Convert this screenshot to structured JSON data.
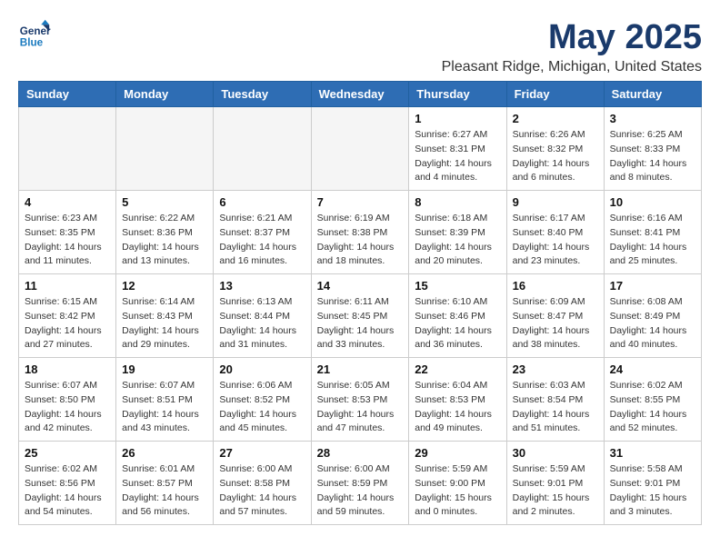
{
  "header": {
    "logo_line1": "General",
    "logo_line2": "Blue",
    "month_title": "May 2025",
    "location": "Pleasant Ridge, Michigan, United States"
  },
  "weekdays": [
    "Sunday",
    "Monday",
    "Tuesday",
    "Wednesday",
    "Thursday",
    "Friday",
    "Saturday"
  ],
  "weeks": [
    [
      {
        "day": "",
        "info": "",
        "empty": true
      },
      {
        "day": "",
        "info": "",
        "empty": true
      },
      {
        "day": "",
        "info": "",
        "empty": true
      },
      {
        "day": "",
        "info": "",
        "empty": true
      },
      {
        "day": "1",
        "info": "Sunrise: 6:27 AM\nSunset: 8:31 PM\nDaylight: 14 hours\nand 4 minutes."
      },
      {
        "day": "2",
        "info": "Sunrise: 6:26 AM\nSunset: 8:32 PM\nDaylight: 14 hours\nand 6 minutes."
      },
      {
        "day": "3",
        "info": "Sunrise: 6:25 AM\nSunset: 8:33 PM\nDaylight: 14 hours\nand 8 minutes."
      }
    ],
    [
      {
        "day": "4",
        "info": "Sunrise: 6:23 AM\nSunset: 8:35 PM\nDaylight: 14 hours\nand 11 minutes."
      },
      {
        "day": "5",
        "info": "Sunrise: 6:22 AM\nSunset: 8:36 PM\nDaylight: 14 hours\nand 13 minutes."
      },
      {
        "day": "6",
        "info": "Sunrise: 6:21 AM\nSunset: 8:37 PM\nDaylight: 14 hours\nand 16 minutes."
      },
      {
        "day": "7",
        "info": "Sunrise: 6:19 AM\nSunset: 8:38 PM\nDaylight: 14 hours\nand 18 minutes."
      },
      {
        "day": "8",
        "info": "Sunrise: 6:18 AM\nSunset: 8:39 PM\nDaylight: 14 hours\nand 20 minutes."
      },
      {
        "day": "9",
        "info": "Sunrise: 6:17 AM\nSunset: 8:40 PM\nDaylight: 14 hours\nand 23 minutes."
      },
      {
        "day": "10",
        "info": "Sunrise: 6:16 AM\nSunset: 8:41 PM\nDaylight: 14 hours\nand 25 minutes."
      }
    ],
    [
      {
        "day": "11",
        "info": "Sunrise: 6:15 AM\nSunset: 8:42 PM\nDaylight: 14 hours\nand 27 minutes."
      },
      {
        "day": "12",
        "info": "Sunrise: 6:14 AM\nSunset: 8:43 PM\nDaylight: 14 hours\nand 29 minutes."
      },
      {
        "day": "13",
        "info": "Sunrise: 6:13 AM\nSunset: 8:44 PM\nDaylight: 14 hours\nand 31 minutes."
      },
      {
        "day": "14",
        "info": "Sunrise: 6:11 AM\nSunset: 8:45 PM\nDaylight: 14 hours\nand 33 minutes."
      },
      {
        "day": "15",
        "info": "Sunrise: 6:10 AM\nSunset: 8:46 PM\nDaylight: 14 hours\nand 36 minutes."
      },
      {
        "day": "16",
        "info": "Sunrise: 6:09 AM\nSunset: 8:47 PM\nDaylight: 14 hours\nand 38 minutes."
      },
      {
        "day": "17",
        "info": "Sunrise: 6:08 AM\nSunset: 8:49 PM\nDaylight: 14 hours\nand 40 minutes."
      }
    ],
    [
      {
        "day": "18",
        "info": "Sunrise: 6:07 AM\nSunset: 8:50 PM\nDaylight: 14 hours\nand 42 minutes."
      },
      {
        "day": "19",
        "info": "Sunrise: 6:07 AM\nSunset: 8:51 PM\nDaylight: 14 hours\nand 43 minutes."
      },
      {
        "day": "20",
        "info": "Sunrise: 6:06 AM\nSunset: 8:52 PM\nDaylight: 14 hours\nand 45 minutes."
      },
      {
        "day": "21",
        "info": "Sunrise: 6:05 AM\nSunset: 8:53 PM\nDaylight: 14 hours\nand 47 minutes."
      },
      {
        "day": "22",
        "info": "Sunrise: 6:04 AM\nSunset: 8:53 PM\nDaylight: 14 hours\nand 49 minutes."
      },
      {
        "day": "23",
        "info": "Sunrise: 6:03 AM\nSunset: 8:54 PM\nDaylight: 14 hours\nand 51 minutes."
      },
      {
        "day": "24",
        "info": "Sunrise: 6:02 AM\nSunset: 8:55 PM\nDaylight: 14 hours\nand 52 minutes."
      }
    ],
    [
      {
        "day": "25",
        "info": "Sunrise: 6:02 AM\nSunset: 8:56 PM\nDaylight: 14 hours\nand 54 minutes."
      },
      {
        "day": "26",
        "info": "Sunrise: 6:01 AM\nSunset: 8:57 PM\nDaylight: 14 hours\nand 56 minutes."
      },
      {
        "day": "27",
        "info": "Sunrise: 6:00 AM\nSunset: 8:58 PM\nDaylight: 14 hours\nand 57 minutes."
      },
      {
        "day": "28",
        "info": "Sunrise: 6:00 AM\nSunset: 8:59 PM\nDaylight: 14 hours\nand 59 minutes."
      },
      {
        "day": "29",
        "info": "Sunrise: 5:59 AM\nSunset: 9:00 PM\nDaylight: 15 hours\nand 0 minutes."
      },
      {
        "day": "30",
        "info": "Sunrise: 5:59 AM\nSunset: 9:01 PM\nDaylight: 15 hours\nand 2 minutes."
      },
      {
        "day": "31",
        "info": "Sunrise: 5:58 AM\nSunset: 9:01 PM\nDaylight: 15 hours\nand 3 minutes."
      }
    ]
  ]
}
